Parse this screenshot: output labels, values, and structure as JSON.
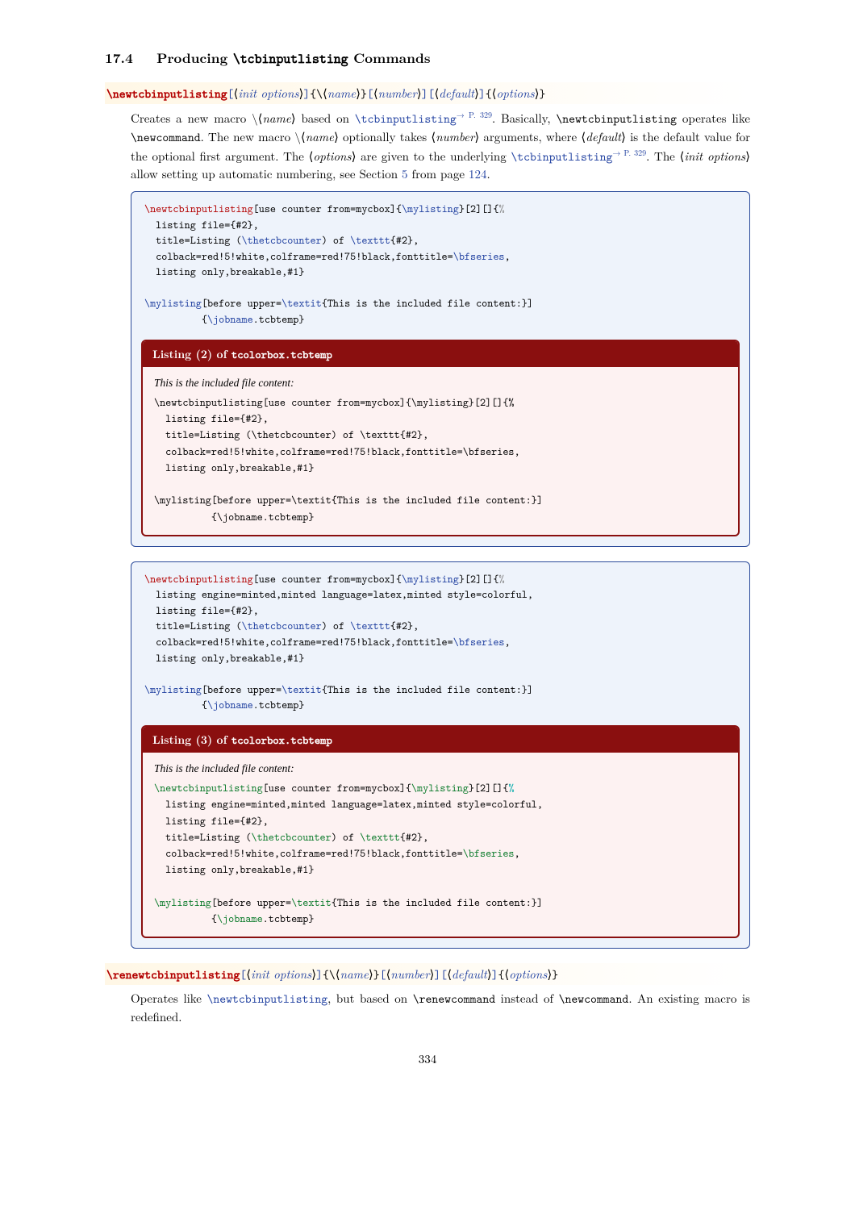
{
  "section": {
    "number": "17.4",
    "title_before": "Producing",
    "title_cmd": "\\tcbinputlisting",
    "title_after": "Commands"
  },
  "cmd1": {
    "name": "\\newtcbinputlisting",
    "args": {
      "init": "init options",
      "a1": "name",
      "a2": "number",
      "a3": "default",
      "a4": "options"
    }
  },
  "desc1": {
    "t1": "Creates a new macro ",
    "name_arg": "name",
    "t2": " based on ",
    "link1": "\\tcbinputlisting",
    "pref1": "→ P. 329",
    "t3": ". Basically, ",
    "code1": "\\newtcbinputlisting",
    "t4": " operates like ",
    "code2": "\\newcommand",
    "t5": ". The new macro ",
    "t6": " optionally takes ",
    "number_arg": "number",
    "t7": " arguments, where ",
    "default_arg": "default",
    "t8": " is the default value for the optional first argument. The ",
    "options_arg": "options",
    "t9": " are given to the underlying ",
    "link2": "\\tcbinputlisting",
    "pref2": "→ P. 329",
    "t10": ". The ",
    "initopt_arg": "init options",
    "t11": " allow setting up automatic numbering, see Section ",
    "sec": "5",
    "t12": " from page ",
    "pg": "124",
    "t13": "."
  },
  "ex1": {
    "src_l1a": "\\newtcbinputlisting",
    "src_l1b": "[use counter from=mycbox]{",
    "src_l1c": "\\mylisting",
    "src_l1d": "}[2][]{",
    "src_l1e": "%",
    "src_l2": "  listing file={#2},",
    "src_l3a": "  title=Listing (",
    "src_l3b": "\\thetcbcounter",
    "src_l3c": ") of ",
    "src_l3d": "\\texttt",
    "src_l3e": "{#2},",
    "src_l4a": "  colback=red!5!white,colframe=red!75!black,fonttitle=",
    "src_l4b": "\\bfseries",
    "src_l4c": ",",
    "src_l5": "  listing only,breakable,#1}",
    "src_blank": "",
    "src_l6a": "\\mylisting",
    "src_l6b": "[before upper=",
    "src_l6c": "\\textit",
    "src_l6d": "{This is the included file content:}]",
    "src_l7a": "          {",
    "src_l7b": "\\jobname",
    "src_l7c": ".tcbtemp}",
    "title_a": "Listing (2) of ",
    "title_b": "tcolorbox.tcbtemp",
    "intro": "This is the included file content:",
    "body_l1": "\\newtcbinputlisting[use counter from=mycbox]{\\mylisting}[2][]{%",
    "body_l2": "  listing file={#2},",
    "body_l3": "  title=Listing (\\thetcbcounter) of \\texttt{#2},",
    "body_l4": "  colback=red!5!white,colframe=red!75!black,fonttitle=\\bfseries,",
    "body_l5": "  listing only,breakable,#1}",
    "body_l6": "",
    "body_l7": "\\mylisting[before upper=\\textit{This is the included file content:}]",
    "body_l8": "          {\\jobname.tcbtemp}"
  },
  "ex2": {
    "src_l1a": "\\newtcbinputlisting",
    "src_l1b": "[use counter from=mycbox]{",
    "src_l1c": "\\mylisting",
    "src_l1d": "}[2][]{",
    "src_l1e": "%",
    "src_l1x": "  listing engine=minted,minted language=latex,minted style=colorful,",
    "src_l2": "  listing file={#2},",
    "src_l3a": "  title=Listing (",
    "src_l3b": "\\thetcbcounter",
    "src_l3c": ") of ",
    "src_l3d": "\\texttt",
    "src_l3e": "{#2},",
    "src_l4a": "  colback=red!5!white,colframe=red!75!black,fonttitle=",
    "src_l4b": "\\bfseries",
    "src_l4c": ",",
    "src_l5": "  listing only,breakable,#1}",
    "src_blank": "",
    "src_l6a": "\\mylisting",
    "src_l6b": "[before upper=",
    "src_l6c": "\\textit",
    "src_l6d": "{This is the included file content:}]",
    "src_l7a": "          {",
    "src_l7b": "\\jobname",
    "src_l7c": ".tcbtemp}",
    "title_a": "Listing (3) of ",
    "title_b": "tcolorbox.tcbtemp",
    "intro": "This is the included file content:",
    "b_l1a": "\\newtcbinputlisting",
    "b_l1b": "[use counter from=mycbox]{",
    "b_l1c": "\\mylisting",
    "b_l1d": "}[2][]{",
    "b_l1e": "%",
    "b_l1x": "  listing engine=minted,minted language=latex,minted style=colorful,",
    "b_l2": "  listing file={#2},",
    "b_l3a": "  title=Listing (",
    "b_l3b": "\\thetcbcounter",
    "b_l3c": ") of ",
    "b_l3d": "\\texttt",
    "b_l3e": "{#2},",
    "b_l4a": "  colback=red!5!white,colframe=red!75!black,fonttitle=",
    "b_l4b": "\\bfseries",
    "b_l4c": ",",
    "b_l5": "  listing only,breakable,#1}",
    "b_l7a": "\\mylisting",
    "b_l7b": "[before upper=",
    "b_l7c": "\\textit",
    "b_l7d": "{This is the included file content:}]",
    "b_l8a": "          {",
    "b_l8b": "\\jobname",
    "b_l8c": ".tcbtemp}"
  },
  "cmd2": {
    "name": "\\renewtcbinputlisting",
    "args": {
      "init": "init options",
      "a1": "name",
      "a2": "number",
      "a3": "default",
      "a4": "options"
    }
  },
  "desc2": {
    "t1": "Operates like ",
    "link": "\\newtcbinputlisting",
    "t2": ", but based on ",
    "c1": "\\renewcommand",
    "t3": " instead of ",
    "c2": "\\newcommand",
    "t4": ". An existing macro is redefined."
  },
  "pagenum": "334"
}
